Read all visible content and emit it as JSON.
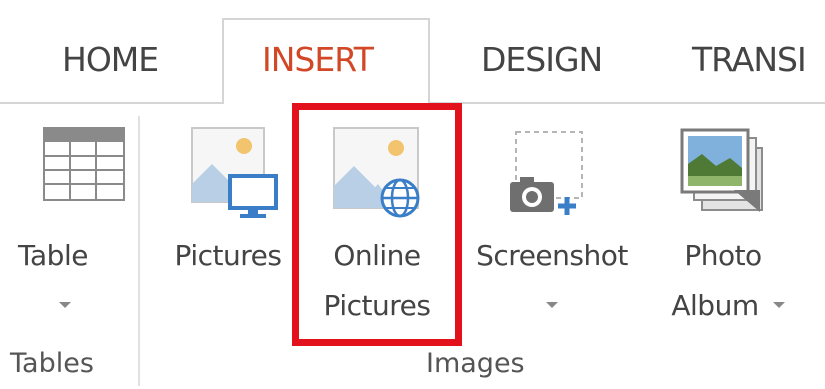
{
  "tabs": {
    "home": "HOME",
    "insert": "INSERT",
    "design": "DESIGN",
    "transitions": "TRANSI"
  },
  "buttons": {
    "table": {
      "label": "Table"
    },
    "pictures": {
      "label": "Pictures"
    },
    "online_pictures": {
      "line1": "Online",
      "line2": "Pictures"
    },
    "screenshot": {
      "label": "Screenshot"
    },
    "photo_album": {
      "line1": "Photo",
      "line2": "Album"
    }
  },
  "groups": {
    "tables": "Tables",
    "images": "Images"
  },
  "colors": {
    "active_tab": "#d24726",
    "highlight": "#e3111c",
    "icon_blue": "#3a7ec8",
    "icon_sun": "#f2c46d"
  }
}
